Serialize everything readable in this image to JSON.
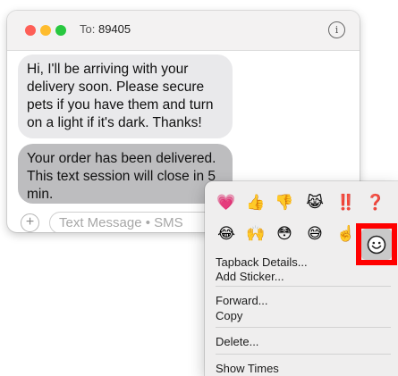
{
  "window": {
    "to_label": "To:",
    "to_value": "89405",
    "info_icon": "info-circle-icon",
    "traffic_colors": {
      "close": "#fe5f57",
      "minimize": "#febc2e",
      "zoom": "#28c840"
    }
  },
  "messages": [
    {
      "text": "Hi, I'll be arriving with your delivery soon. Please secure pets if you have them and turn on a light if it's dark. Thanks!"
    },
    {
      "text": "Your order has been delivered. This text session will close in 5 min."
    }
  ],
  "composer": {
    "plus_label": "+",
    "placeholder": "Text Message • SMS"
  },
  "tapbacks": {
    "row1": [
      "💗",
      "👍",
      "👎",
      "😹",
      "‼️",
      "❓"
    ],
    "row2": [
      "😂",
      "🙌",
      "😳",
      "😅",
      "☝️"
    ],
    "more_icon": "smiley-icon"
  },
  "menu": {
    "tapback_details": "Tapback Details...",
    "add_sticker": "Add Sticker...",
    "forward": "Forward...",
    "copy": "Copy",
    "delete": "Delete...",
    "show_times": "Show Times"
  },
  "colors": {
    "highlight": "#ff0000",
    "received_bubble": "#e9e9eb",
    "selected_bubble": "#bdbdbf"
  }
}
